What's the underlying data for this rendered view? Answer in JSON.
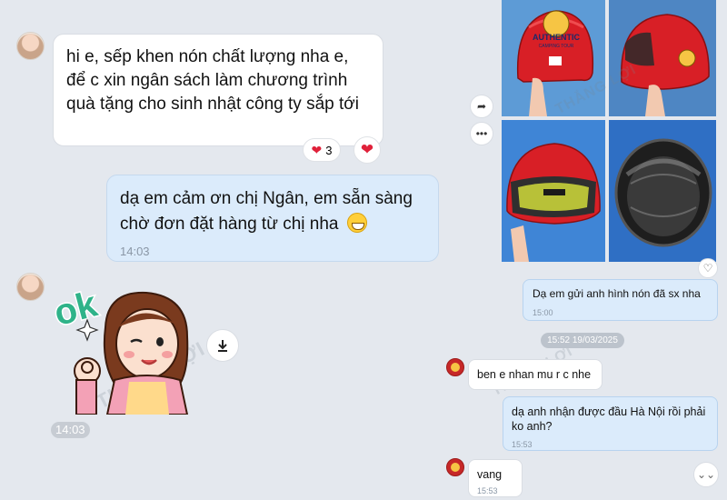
{
  "left_chat": {
    "msg1_text": "hi e, sếp khen nón chất lượng nha e, để c xin ngân sách làm chương trình quà tặng cho sinh nhật công ty sắp tới",
    "msg1_reaction_count": "3",
    "msg2_text": "dạ em cảm ơn chị Ngân, em sẵn sàng chờ đơn đặt hàng từ chị nha",
    "msg2_time": "14:03",
    "sticker_text": "ok",
    "sticker_time": "14:03"
  },
  "right_chat": {
    "msg1_text": "Dạ em gửi anh hình nón đã sx nha",
    "msg1_time": "15:00",
    "date_chip": "15:52 19/03/2025",
    "msg2_text": "ben e nhan mu r c nhe",
    "msg3_text": "dạ anh nhận được đầu Hà Nội rồi phải ko anh?",
    "msg3_time": "15:53",
    "msg4_text": "vang",
    "msg4_time": "15:53"
  },
  "watermark": "THẮNG LỢI",
  "helmet": {
    "badge_text": "AUTHENTIC",
    "badge_subtext": "CAMPING TOUR"
  },
  "colors": {
    "chat_bg": "#e4e8ee",
    "outgoing_bubble": "#dbebfb",
    "incoming_bubble": "#ffffff",
    "heart": "#e0213a",
    "helmet_red": "#d81f26"
  }
}
